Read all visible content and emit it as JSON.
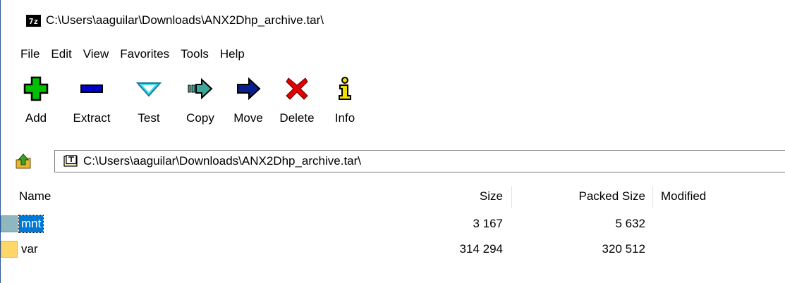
{
  "window": {
    "title": "C:\\Users\\aaguilar\\Downloads\\ANX2Dhp_archive.tar\\",
    "app_icon_text": "7z"
  },
  "menu": {
    "items": [
      "File",
      "Edit",
      "View",
      "Favorites",
      "Tools",
      "Help"
    ]
  },
  "toolbar": {
    "buttons": [
      {
        "label": "Add",
        "icon": "add-plus-icon"
      },
      {
        "label": "Extract",
        "icon": "extract-minus-icon"
      },
      {
        "label": "Test",
        "icon": "test-check-icon"
      },
      {
        "label": "Copy",
        "icon": "copy-arrow-icon"
      },
      {
        "label": "Move",
        "icon": "move-arrow-icon"
      },
      {
        "label": "Delete",
        "icon": "delete-x-icon"
      },
      {
        "label": "Info",
        "icon": "info-icon"
      }
    ]
  },
  "address": {
    "path": "C:\\Users\\aaguilar\\Downloads\\ANX2Dhp_archive.tar\\",
    "up_icon": "up-folder-icon",
    "path_icon": "archive-type-icon"
  },
  "list": {
    "columns": [
      "Name",
      "Size",
      "Packed Size",
      "Modified"
    ],
    "rows": [
      {
        "name": "mnt",
        "size": "3 167",
        "packed_size": "5 632",
        "modified": "",
        "selected": true
      },
      {
        "name": "var",
        "size": "314 294",
        "packed_size": "320 512",
        "modified": "",
        "selected": false
      }
    ]
  },
  "colors": {
    "selection": "#0078d7",
    "add_green": "#00c000",
    "extract_blue": "#0000c0",
    "test_cyan": "#40e0f0",
    "copy_teal": "#3aa79a",
    "move_navy": "#0a1f8f",
    "delete_red": "#e00000",
    "info_yellow": "#f0e000",
    "folder_selected": "#8fb7c0",
    "folder_normal": "#ffd769"
  }
}
